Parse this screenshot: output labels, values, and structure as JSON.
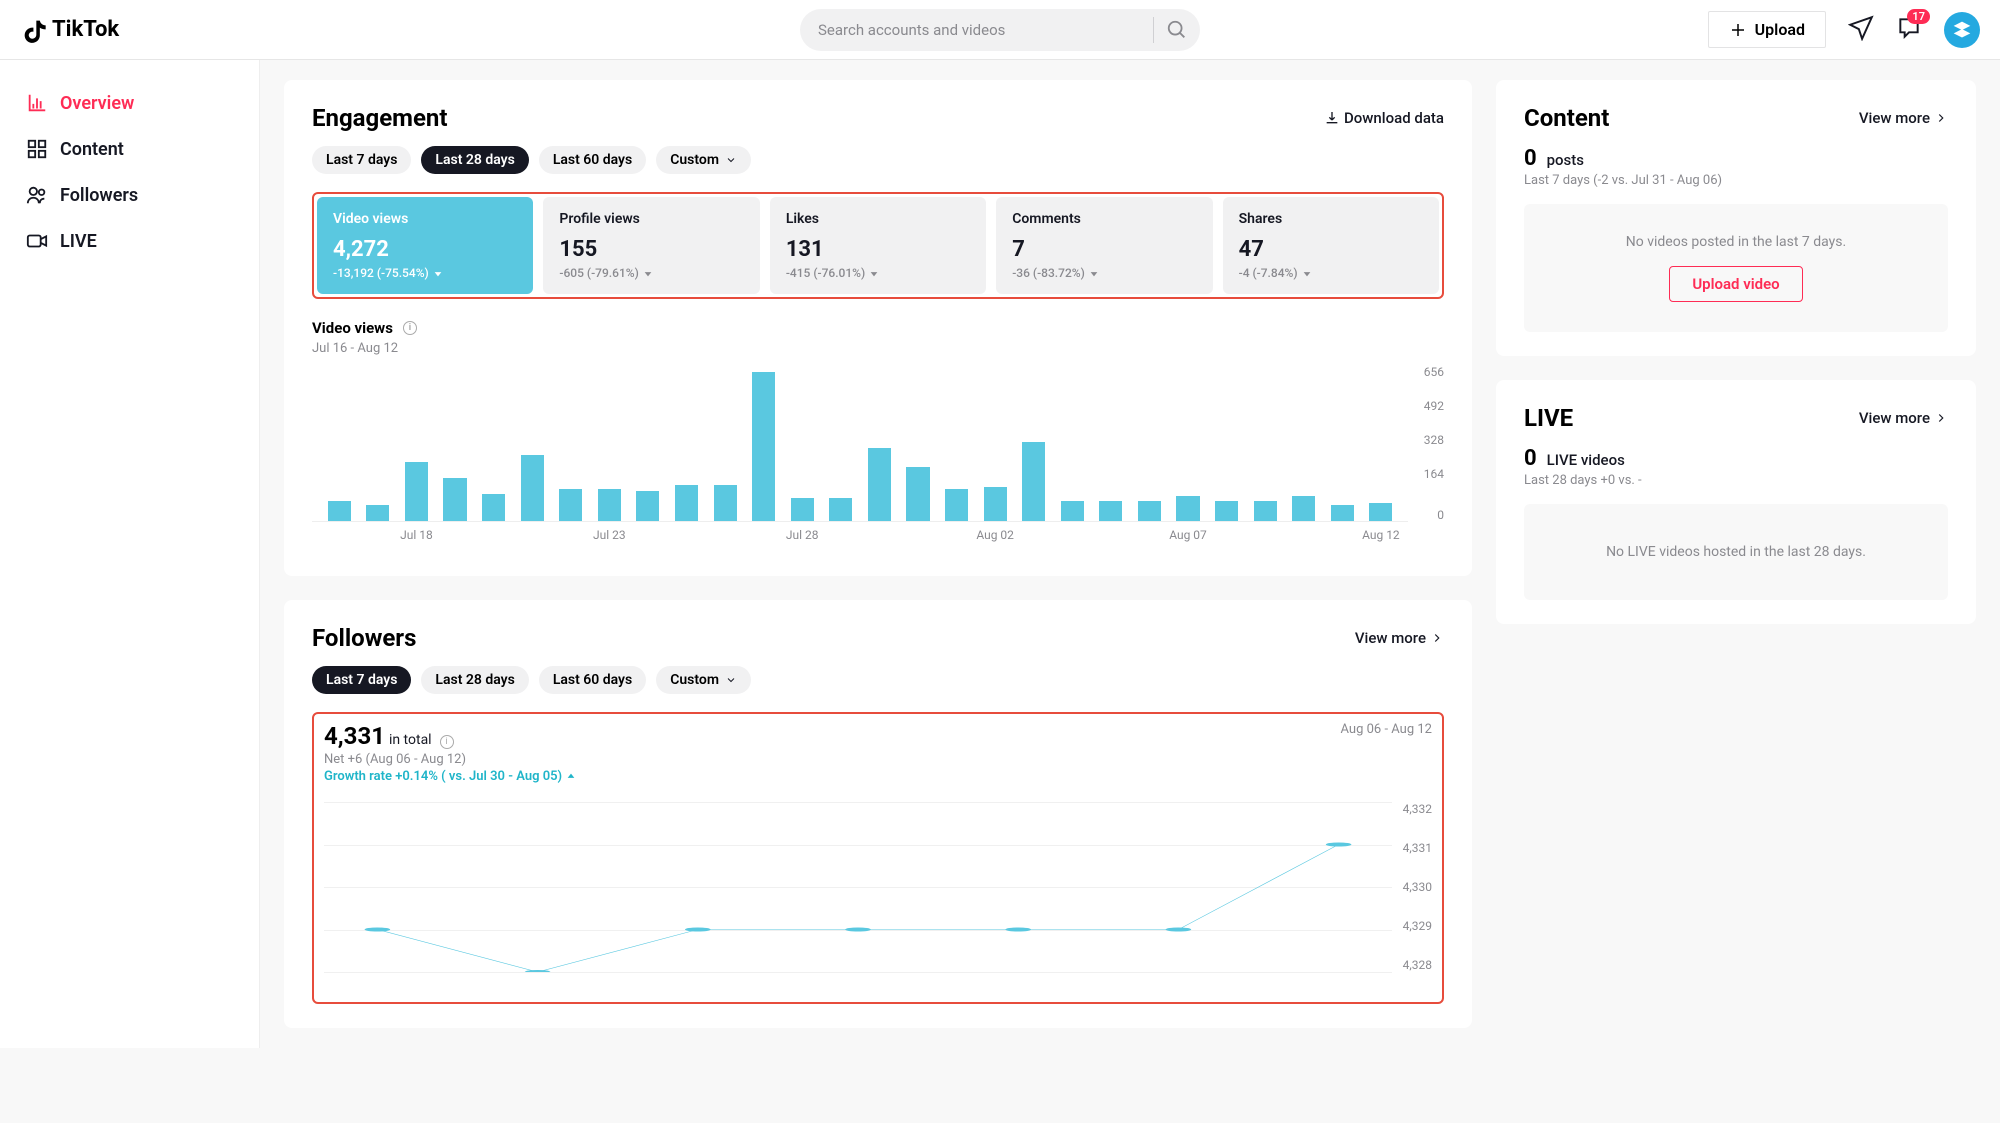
{
  "header": {
    "brand": "TikTok",
    "search_placeholder": "Search accounts and videos",
    "upload_label": "Upload",
    "inbox_badge": "17"
  },
  "sidebar": {
    "overview": "Overview",
    "content": "Content",
    "followers": "Followers",
    "live": "LIVE"
  },
  "engagement": {
    "title": "Engagement",
    "download": "Download data",
    "tabs": {
      "t7": "Last 7 days",
      "t28": "Last 28 days",
      "t60": "Last 60 days",
      "custom": "Custom"
    },
    "metrics": [
      {
        "label": "Video views",
        "value": "4,272",
        "change": "-13,192 (-75.54%)"
      },
      {
        "label": "Profile views",
        "value": "155",
        "change": "-605 (-79.61%)"
      },
      {
        "label": "Likes",
        "value": "131",
        "change": "-415 (-76.01%)"
      },
      {
        "label": "Comments",
        "value": "7",
        "change": "-36 (-83.72%)"
      },
      {
        "label": "Shares",
        "value": "47",
        "change": "-4 (-7.84%)"
      }
    ],
    "chart_title": "Video views",
    "chart_range": "Jul 16 - Aug 12"
  },
  "followers_section": {
    "title": "Followers",
    "view_more": "View more",
    "tabs": {
      "t7": "Last 7 days",
      "t28": "Last 28 days",
      "t60": "Last 60 days",
      "custom": "Custom"
    },
    "total": "4,331",
    "total_suffix": "in total",
    "net": "Net +6 (Aug 06 - Aug 12)",
    "growth": "Growth rate +0.14% ( vs. Jul 30 - Aug 05)",
    "date_range": "Aug 06 - Aug 12"
  },
  "content_card": {
    "title": "Content",
    "view_more": "View more",
    "stat_value": "0",
    "stat_label": "posts",
    "subtext": "Last 7 days (-2 vs. Jul 31 - Aug 06)",
    "empty": "No videos posted in the last 7 days.",
    "upload_btn": "Upload video"
  },
  "live_card": {
    "title": "LIVE",
    "view_more": "View more",
    "stat_value": "0",
    "stat_label": "LIVE videos",
    "subtext": "Last 28 days +0 vs. -",
    "empty": "No LIVE videos hosted in the last 28 days."
  },
  "chart_data": [
    {
      "type": "bar",
      "title": "Video views",
      "xlabel": "",
      "ylabel": "",
      "ylim": [
        0,
        656
      ],
      "y_ticks": [
        656,
        492,
        328,
        164,
        0
      ],
      "categories": [
        "Jul 16",
        "Jul 17",
        "Jul 18",
        "Jul 19",
        "Jul 20",
        "Jul 21",
        "Jul 22",
        "Jul 23",
        "Jul 24",
        "Jul 25",
        "Jul 26",
        "Jul 27",
        "Jul 28",
        "Jul 29",
        "Jul 30",
        "Jul 31",
        "Aug 01",
        "Aug 02",
        "Aug 03",
        "Aug 04",
        "Aug 05",
        "Aug 06",
        "Aug 07",
        "Aug 08",
        "Aug 09",
        "Aug 10",
        "Aug 11",
        "Aug 12"
      ],
      "values": [
        90,
        70,
        260,
        190,
        120,
        290,
        140,
        140,
        130,
        160,
        160,
        656,
        100,
        100,
        320,
        240,
        140,
        150,
        350,
        90,
        90,
        90,
        110,
        90,
        90,
        110,
        70,
        80
      ],
      "x_tick_labels": [
        "Jul 18",
        "Jul 23",
        "Jul 28",
        "Aug 02",
        "Aug 07",
        "Aug 12"
      ]
    },
    {
      "type": "line",
      "title": "Followers",
      "xlabel": "",
      "ylabel": "",
      "ylim": [
        4328,
        4332
      ],
      "y_ticks": [
        4332,
        4331,
        4330,
        4329,
        4328
      ],
      "y_tick_labels": [
        "4,332",
        "4,331",
        "4,330",
        "4,329",
        "4,328"
      ],
      "categories": [
        "Aug 06",
        "Aug 07",
        "Aug 08",
        "Aug 09",
        "Aug 10",
        "Aug 11",
        "Aug 12"
      ],
      "values": [
        4329,
        4328,
        4329,
        4329,
        4329,
        4329,
        4331
      ]
    }
  ]
}
